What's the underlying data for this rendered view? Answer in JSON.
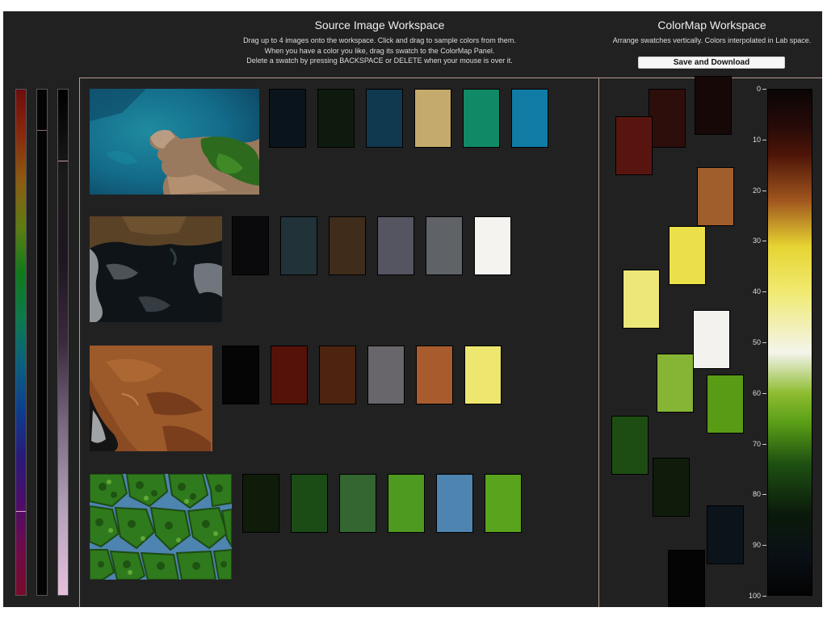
{
  "source_panel": {
    "title": "Source Image Workspace",
    "instructions": [
      "Drag up to 4 images onto the workspace.  Click and drag to sample colors from them.",
      "When you have a color you like, drag its swatch to the ColorMap Panel.",
      "Delete a swatch by pressing BACKSPACE or DELETE when your mouse is over it."
    ]
  },
  "colormap_panel": {
    "title": "ColorMap Workspace",
    "instructions": "Arrange swatches vertically. Colors interpolated in Lab space.",
    "save_label": "Save and Download"
  },
  "colors": {
    "background": "#212121",
    "divider": "#b89a8c"
  },
  "image_rows": [
    {
      "image": "aerial-coastline-thumbnail",
      "swatches": [
        "#0a141d",
        "#0f1a0f",
        "#10384f",
        "#c4aa6c",
        "#108a66",
        "#107ca6"
      ]
    },
    {
      "image": "satellite-clouds-thumbnail",
      "swatches": [
        "#0a0a0c",
        "#213238",
        "#402c1a",
        "#545560",
        "#5f6266",
        "#f4f3ef"
      ]
    },
    {
      "image": "satellite-desert-thumbnail",
      "swatches": [
        "#050505",
        "#551208",
        "#4d2410",
        "#68666b",
        "#a85c2e",
        "#ede76f"
      ]
    },
    {
      "image": "leaf-cells-thumbnail",
      "swatches": [
        "#0f1c0a",
        "#1c4c16",
        "#336630",
        "#4e9a20",
        "#4d84b0",
        "#59a31d"
      ]
    }
  ],
  "colormap_swatches": [
    "#170808",
    "#2e0e0b",
    "#581510",
    "#a05e2c",
    "#ece04a",
    "#ede779",
    "#f4f2ee",
    "#86b434",
    "#5a9b16",
    "#1e4d13",
    "#0f1c0c",
    "#0b131b",
    "#040404"
  ],
  "colormap_ticks": [
    "0",
    "10",
    "20",
    "30",
    "40",
    "50",
    "60",
    "70",
    "80",
    "90",
    "100"
  ],
  "colormap_gradient_stops": [
    {
      "pos": 0.0,
      "color": "#0a0606"
    },
    {
      "pos": 0.07,
      "color": "#250a08"
    },
    {
      "pos": 0.13,
      "color": "#4e1508"
    },
    {
      "pos": 0.22,
      "color": "#a0561e"
    },
    {
      "pos": 0.31,
      "color": "#e6d432"
    },
    {
      "pos": 0.4,
      "color": "#f0ea70"
    },
    {
      "pos": 0.52,
      "color": "#f4f4ec"
    },
    {
      "pos": 0.6,
      "color": "#8fbd32"
    },
    {
      "pos": 0.66,
      "color": "#599e16"
    },
    {
      "pos": 0.74,
      "color": "#1e5012"
    },
    {
      "pos": 0.84,
      "color": "#0a1a0a"
    },
    {
      "pos": 0.92,
      "color": "#0a1016"
    },
    {
      "pos": 1.0,
      "color": "#030303"
    }
  ],
  "preview_bars": {
    "spectrum_stops": [
      "#6e0d0d",
      "#8a2a0d",
      "#8c5c10",
      "#5e7d12",
      "#0f7a1a",
      "#0b7a4e",
      "#0a6080",
      "#0d3d8e",
      "#2a1a7a",
      "#4c0e6a",
      "#6e0b4a",
      "#7a0a2a"
    ],
    "lightness_stops": [
      "#000000",
      "#1a1a1a",
      "#1e1620",
      "#3a2a3c",
      "#7a6a82",
      "#b4a2b8",
      "#e6c0dc"
    ]
  }
}
